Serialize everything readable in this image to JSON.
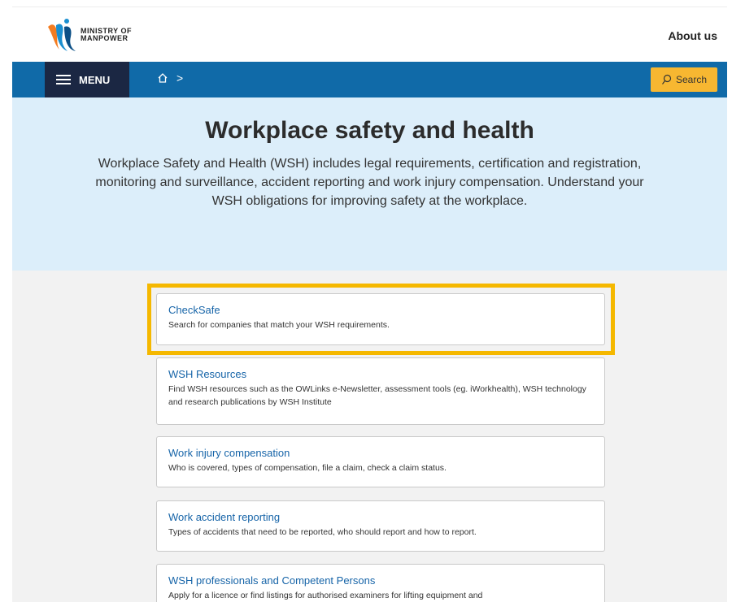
{
  "header": {
    "logo_line1": "MINISTRY OF",
    "logo_line2": "MANPOWER",
    "about_label": "About us"
  },
  "nav": {
    "menu_label": "MENU",
    "home_icon": "home-icon",
    "breadcrumb_sep": ">",
    "search_label": "Search"
  },
  "hero": {
    "title": "Workplace safety and health",
    "description": "Workplace Safety and Health (WSH) includes legal requirements, certification and registration, monitoring and surveillance, accident reporting and work injury compensation. Understand your WSH obligations for improving safety at the workplace."
  },
  "cards": [
    {
      "title": "CheckSafe",
      "desc": "Search for companies that match your WSH requirements."
    },
    {
      "title": "WSH Resources",
      "desc": "Find WSH resources such as the OWLinks e-Newsletter, assessment tools (eg. iWorkhealth), WSH technology and research publications by WSH Institute"
    },
    {
      "title": "Work injury compensation",
      "desc": "Who is covered, types of compensation, file a claim, check a claim status."
    },
    {
      "title": "Work accident reporting",
      "desc": "Types of accidents that need to be reported, who should report and how to report."
    },
    {
      "title": "WSH professionals and Competent Persons",
      "desc": "Apply for a licence or find listings for authorised examiners for lifting equipment and"
    }
  ],
  "colors": {
    "nav_blue": "#106aa8",
    "menu_dark": "#1b2743",
    "search_yellow": "#f7b731",
    "hero_bg": "#dceefa",
    "link_blue": "#1664a8",
    "highlight": "#f5b800"
  }
}
